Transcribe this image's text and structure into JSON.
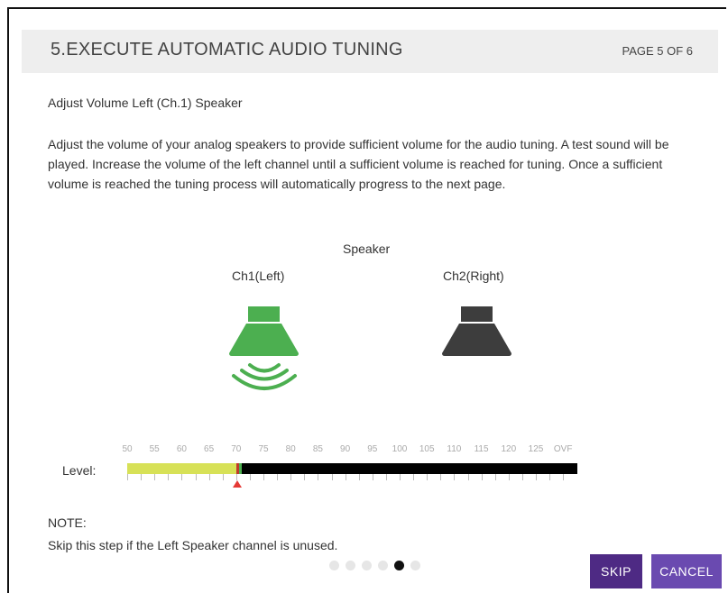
{
  "header": {
    "title": "5.EXECUTE AUTOMATIC AUDIO TUNING",
    "page_indicator": "PAGE 5 OF 6"
  },
  "subtitle": "Adjust Volume Left (Ch.1) Speaker",
  "description": "Adjust the volume of your analog speakers to provide sufficient volume for the audio tuning. A test sound will be played. Increase the volume of the left channel until a sufficient volume is reached for tuning. Once a sufficient volume is reached the tuning process will automatically progress to the next page.",
  "speakers": {
    "heading": "Speaker",
    "ch1": {
      "label": "Ch1(Left)",
      "active": true,
      "icon": "speaker-active-icon"
    },
    "ch2": {
      "label": "Ch2(Right)",
      "active": false,
      "icon": "speaker-inactive-icon"
    }
  },
  "level": {
    "label": "Level:",
    "scale": [
      "50",
      "55",
      "60",
      "65",
      "70",
      "75",
      "80",
      "85",
      "90",
      "95",
      "100",
      "105",
      "110",
      "115",
      "120",
      "125",
      "OVF"
    ],
    "current_level": 70,
    "target_level": 70
  },
  "note": {
    "title": "NOTE:",
    "text": "Skip this step if the Left Speaker channel is unused."
  },
  "pagination": {
    "total": 6,
    "current": 5
  },
  "buttons": {
    "skip": "SKIP",
    "cancel": "CANCEL"
  },
  "colors": {
    "active_speaker": "#4caf50",
    "inactive_speaker": "#3d3d3d",
    "meter_fill": "#d7e157",
    "meter_bg": "#000000",
    "marker": "#e53935",
    "skip_button": "#4e2a84",
    "cancel_button": "#6a4ab0"
  }
}
